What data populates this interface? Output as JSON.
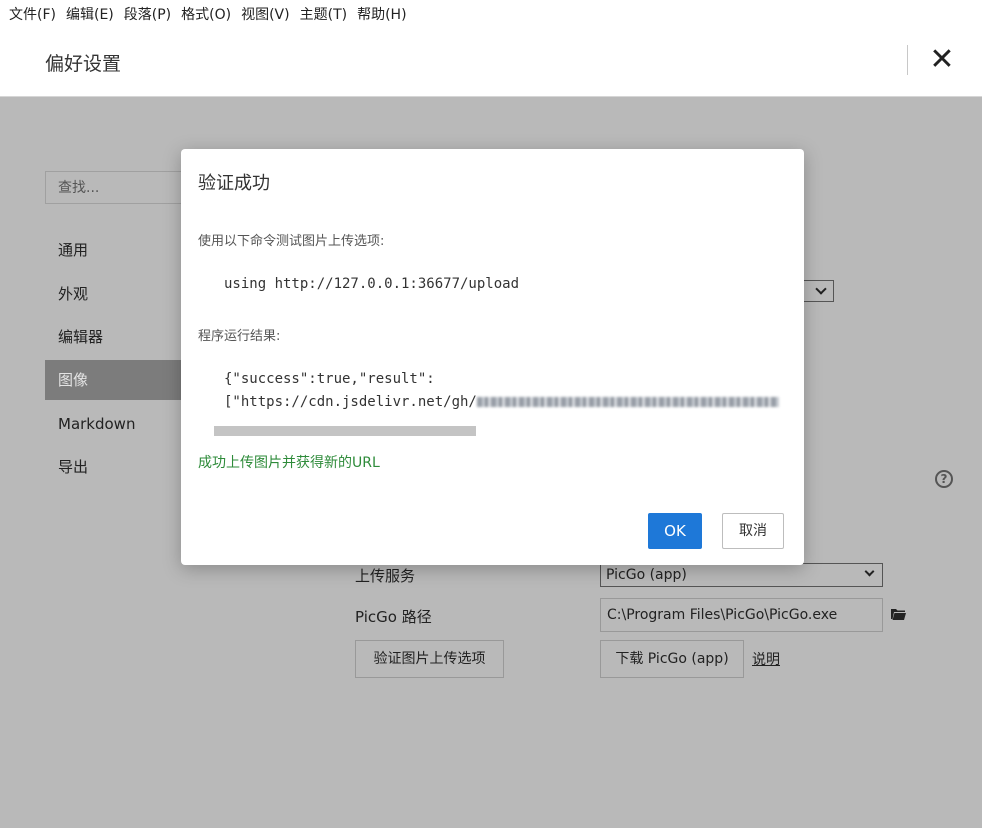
{
  "menu": [
    "文件(F)",
    "编辑(E)",
    "段落(P)",
    "格式(O)",
    "视图(V)",
    "主题(T)",
    "帮助(H)"
  ],
  "prefs": {
    "title": "偏好设置",
    "close_glyph": "✕",
    "search_placeholder": "查找...",
    "nav": [
      "通用",
      "外观",
      "编辑器",
      "图像",
      "Markdown",
      "导出"
    ],
    "active_nav": "图像",
    "help_glyph": "?",
    "upload_service_label": "上传服务",
    "upload_service_value": "PicGo (app)",
    "picgo_path_label": "PicGo 路径",
    "picgo_path_value": "C:\\Program Files\\PicGo\\PicGo.exe",
    "verify_button": "验证图片上传选项",
    "download_button": "下载 PicGo (app)",
    "explain_link": "说明"
  },
  "dialog": {
    "title": "验证成功",
    "command_label": "使用以下命令测试图片上传选项:",
    "command": "using http://127.0.0.1:36677/upload",
    "result_label": "程序运行结果:",
    "result_line1": "{\"success\":true,\"result\":",
    "result_line2": "[\"https://cdn.jsdelivr.net/gh/",
    "success_message": "成功上传图片并获得新的URL",
    "ok_label": "OK",
    "cancel_label": "取消"
  },
  "colors": {
    "accent": "#1e78d8",
    "success": "#2e8b3a",
    "overlay": "#b9b9b9",
    "active_nav_bg": "#7c7c7c"
  }
}
